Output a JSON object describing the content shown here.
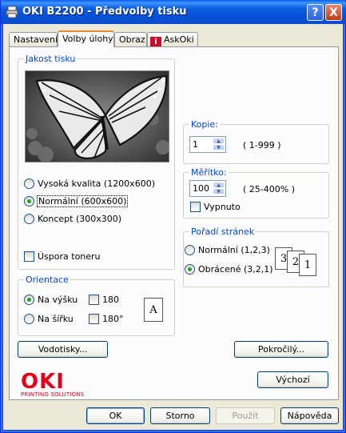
{
  "window": {
    "title": "OKI B2200 - Předvolby tisku",
    "help_btn": "?",
    "close_btn": "X"
  },
  "tabs": [
    {
      "label": "Nastavení"
    },
    {
      "label": "Volby úlohy"
    },
    {
      "label": "Obraz"
    },
    {
      "label": "AskOki"
    }
  ],
  "quality": {
    "legend": "Jakost tisku",
    "options": [
      {
        "label": "Vysoká kvalita (1200x600)",
        "selected": false
      },
      {
        "label": "Normální (600x600)",
        "selected": true
      },
      {
        "label": "Koncept (300x300)",
        "selected": false
      }
    ],
    "toner_save": {
      "label": "Úspora toneru",
      "checked": false
    }
  },
  "orientation": {
    "legend": "Orientace",
    "portrait": "Na výšku",
    "landscape": "Na šířku",
    "rotate1": "180",
    "rotate2": "180°",
    "paper_letter": "A"
  },
  "copies": {
    "legend": "Kopie:",
    "value": "1",
    "range": "( 1-999 )"
  },
  "scale": {
    "legend": "Měřítko:",
    "value": "100",
    "range": "( 25-400% )",
    "off_label": "Vypnuto"
  },
  "page_order": {
    "legend": "Pořadí stránek",
    "normal": "Normální (1,2,3)",
    "reversed": "Obrácené (3,2,1)",
    "icon_pages": [
      "3",
      "2",
      "1"
    ]
  },
  "buttons": {
    "watermarks": "Vodotisky...",
    "advanced": "Pokročilý...",
    "default": "Výchozí",
    "ok": "OK",
    "cancel": "Storno",
    "apply": "Použít",
    "help": "Nápověda"
  },
  "logo": {
    "name": "OKI",
    "tagline": "PRINTING SOLUTIONS"
  },
  "colors": {
    "titlebar": "#0b5edf",
    "legend_text": "#0046d5",
    "brand": "#e2001a",
    "radio_dot": "#21a121"
  }
}
